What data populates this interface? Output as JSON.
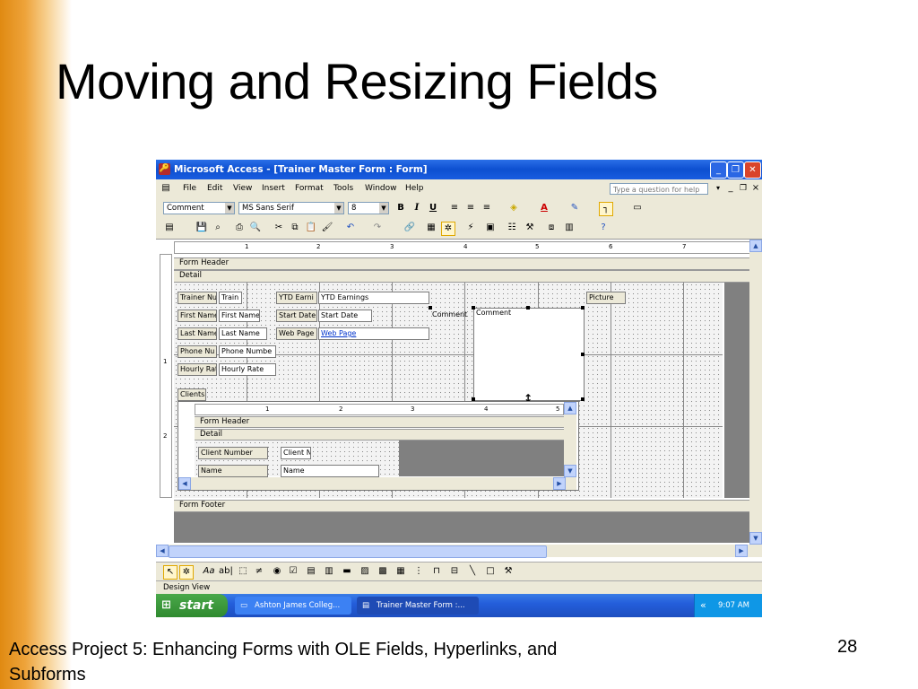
{
  "slide": {
    "title": "Moving and Resizing Fields",
    "footer_text": "Access Project 5: Enhancing Forms with OLE Fields, Hyperlinks, and Subforms",
    "page_number": "28"
  },
  "window": {
    "title": "Microsoft Access - [Trainer Master Form : Form]",
    "controls": {
      "minimize": "_",
      "restore": "❐",
      "close": "✕"
    }
  },
  "menu": {
    "items": [
      "File",
      "Edit",
      "View",
      "Insert",
      "Format",
      "Tools",
      "Window",
      "Help"
    ],
    "help_placeholder": "Type a question for help"
  },
  "formatting_toolbar": {
    "object_combo": "Comment",
    "font_combo": "MS Sans Serif",
    "size_combo": "8",
    "bold": "B",
    "italic": "I",
    "underline": "U"
  },
  "design": {
    "form_header_label": "Form Header",
    "detail_label": "Detail",
    "form_footer_label": "Form Footer",
    "ruler_marks": [
      "1",
      "2",
      "3",
      "4",
      "5",
      "6",
      "7"
    ],
    "left_ruler_marks": [
      "1",
      "2"
    ],
    "fields": {
      "trainer_num_label": "Trainer Nu",
      "trainer_num_box": "Train",
      "first_name_label": "First Name",
      "first_name_box": "First Name",
      "last_name_label": "Last Name",
      "last_name_box": "Last Name",
      "phone_label": "Phone Nu",
      "phone_box": "Phone Numbe",
      "hourly_label": "Hourly Rat",
      "hourly_box": "Hourly Rate",
      "ytd_label": "YTD Earni",
      "ytd_box": "YTD Earnings",
      "start_label": "Start Date",
      "start_box": "Start Date",
      "webpage_label": "Web Page",
      "webpage_box": "Web Page",
      "comment_label": "Comment",
      "comment_box": "Comment",
      "picture_label": "Picture",
      "clients_label": "Clients"
    },
    "subform": {
      "ruler_marks": [
        "1",
        "2",
        "3",
        "4",
        "5"
      ],
      "form_header_label": "Form Header",
      "detail_label": "Detail",
      "client_number_label": "Client Number",
      "client_number_box": "Client N",
      "name_label": "Name",
      "name_box": "Name"
    }
  },
  "status": {
    "text": "Design View"
  },
  "taskbar": {
    "start_label": "start",
    "tasks": [
      "Ashton James Colleg...",
      "Trainer Master Form :..."
    ],
    "clock": "9:07 AM"
  },
  "colors": {
    "accent_orange": "#e08a12",
    "xp_blue": "#245edb",
    "start_green": "#2f8a2f"
  }
}
